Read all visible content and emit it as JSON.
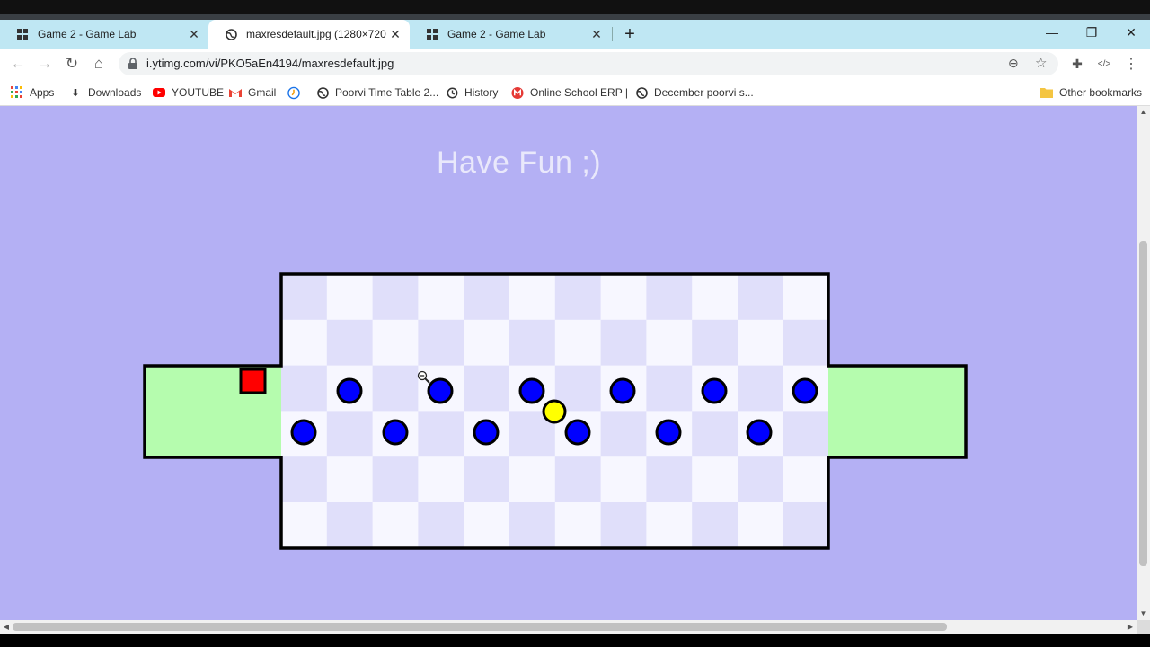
{
  "browser": {
    "tabs": [
      {
        "title": "Game 2 - Game Lab",
        "active": false,
        "favicon": "grid-icon"
      },
      {
        "title": "maxresdefault.jpg (1280×720)",
        "active": true,
        "favicon": "globe-icon"
      },
      {
        "title": "Game 2 - Game Lab",
        "active": false,
        "favicon": "grid-icon"
      }
    ],
    "new_tab": "+",
    "url": "i.ytimg.com/vi/PKO5aEn4194/maxresdefault.jpg",
    "bookmarks": [
      {
        "label": "Apps",
        "icon": "apps-grid-icon"
      },
      {
        "label": "Downloads",
        "icon": "download-icon"
      },
      {
        "label": "YOUTUBE",
        "icon": "youtube-icon"
      },
      {
        "label": "Gmail",
        "icon": "gmail-icon"
      },
      {
        "label": "",
        "icon": "clock-badge-icon"
      },
      {
        "label": "Poorvi Time Table 2...",
        "icon": "globe-icon"
      },
      {
        "label": "History",
        "icon": "history-icon"
      },
      {
        "label": "Online School ERP |",
        "icon": "erp-icon"
      },
      {
        "label": "December poorvi s...",
        "icon": "globe-icon"
      }
    ],
    "other_bookmarks": "Other bookmarks"
  },
  "page": {
    "headline": "Have Fun ;)"
  },
  "game": {
    "board_colors": {
      "light": "#f7f7ff",
      "dark": "#e0dffa",
      "safe": "#b5fcae",
      "background": "#b4b0f4"
    },
    "player": {
      "color": "#ff0000"
    },
    "coin": {
      "color": "#ffff00"
    },
    "enemy_color": "#0000ff"
  }
}
